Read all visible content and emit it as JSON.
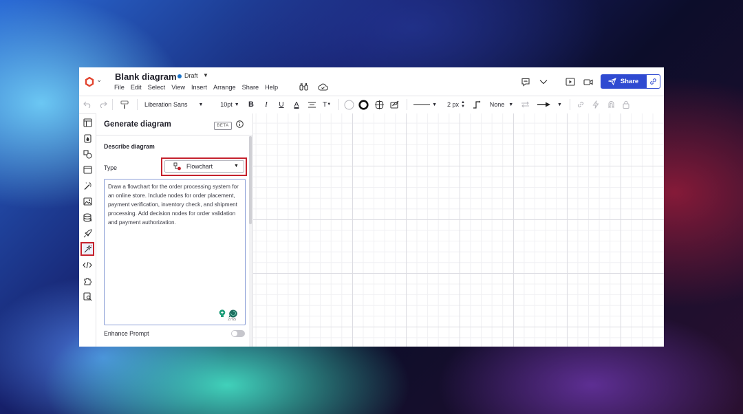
{
  "app": {
    "title": "Blank diagram",
    "status": "Draft",
    "menu": [
      "File",
      "Edit",
      "Select",
      "View",
      "Insert",
      "Arrange",
      "Share",
      "Help"
    ],
    "share_label": "Share"
  },
  "toolbar": {
    "font": "Liberation Sans",
    "font_size": "10pt",
    "bold": "B",
    "italic": "I",
    "underline": "U",
    "text_color": "A",
    "text_options": "T",
    "line_width": "2 px",
    "line_end": "None"
  },
  "panel": {
    "title": "Generate diagram",
    "badge": "BETA",
    "section": "Describe diagram",
    "type_label": "Type",
    "type_value": "Flowchart",
    "prompt": "Draw a flowchart for the order processing system for an online store. Include nodes for order placement, payment verification, inventory check, and shipment processing. Add decision nodes for order validation and payment authorization.",
    "char_count": "2765",
    "enhance_label": "Enhance Prompt",
    "enhance_on": false
  },
  "colors": {
    "accent": "#2f4ad1",
    "highlight": "#c5212c",
    "draft_dot": "#1a73c9"
  },
  "icons": {
    "rail": [
      "layout-icon",
      "fill-icon",
      "shapes-icon",
      "frame-icon",
      "magic-wand-icon",
      "image-icon",
      "database-icon",
      "rocket-icon",
      "ai-sparkle-icon",
      "code-icon",
      "plugin-icon",
      "search-doc-icon"
    ]
  }
}
